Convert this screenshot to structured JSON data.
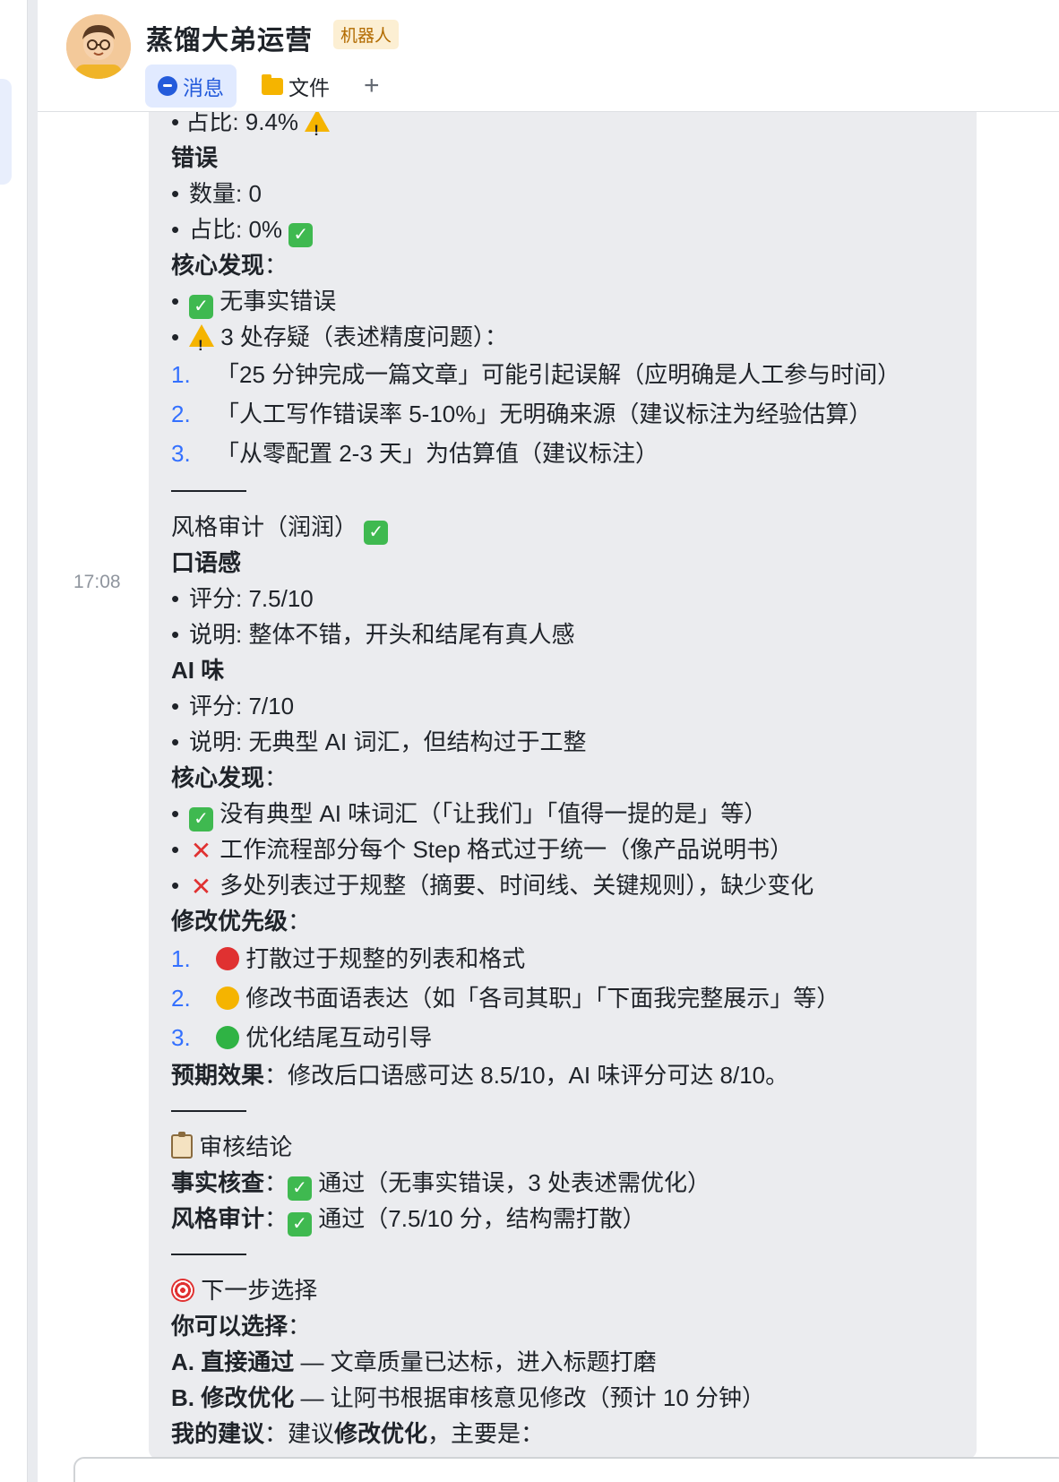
{
  "header": {
    "title": "蒸馏大弟运营",
    "badge": "机器人",
    "tabs": [
      {
        "label": "消息",
        "icon": "chat-bubble-icon",
        "active": true
      },
      {
        "label": "文件",
        "icon": "folder-icon",
        "active": false
      }
    ],
    "add_tab": "+"
  },
  "message": {
    "time": "17:08",
    "lines": {
      "l0": "• 占比: 9.4%",
      "l1": "错误",
      "l2": "数量: 0",
      "l3": "占比: 0%",
      "l4": "核心发现",
      "l4b": "：",
      "l5": "无事实错误",
      "l6": "3 处存疑（表述精度问题）：",
      "l7": "「25 分钟完成一篇文章」可能引起误解（应明确是人工参与时间）",
      "l8": "「人工写作错误率 5-10%」无明确来源（建议标注为经验估算）",
      "l9": "「从零配置 2-3 天」为估算值（建议标注）",
      "l10": "风格审计（润润）",
      "l11": "口语感",
      "l12": "评分: 7.5/10",
      "l13": "说明: 整体不错，开头和结尾有真人感",
      "l14": "AI 味",
      "l15": "评分: 7/10",
      "l16": "说明: 无典型 AI 词汇，但结构过于工整",
      "l17": "核心发现",
      "l17b": "：",
      "l18": "没有典型 AI 味词汇（「让我们」「值得一提的是」等）",
      "l19": "工作流程部分每个 Step 格式过于统一（像产品说明书）",
      "l20": "多处列表过于规整（摘要、时间线、关键规则），缺少变化",
      "l21": "修改优先级",
      "l21b": "：",
      "l22": "打散过于规整的列表和格式",
      "l23": "修改书面语表达（如「各司其职」「下面我完整展示」等）",
      "l24": "优化结尾互动引导",
      "l25a": "预期效果",
      "l25b": "：修改后口语感可达 8.5/10，AI 味评分可达 8/10。",
      "l26": "审核结论",
      "l27a": "事实核查",
      "l27b": "：",
      "l27c": "通过（无事实错误，3 处表述需优化）",
      "l28a": "风格审计",
      "l28b": "：",
      "l28c": "通过（7.5/10 分，结构需打散）",
      "l29": "下一步选择",
      "l30": "你可以选择",
      "l30b": "：",
      "l31a": "A. 直接通过",
      "l31b": " — 文章质量已达标，进入标题打磨",
      "l32a": "B. 修改优化",
      "l32b": " — 让阿书根据审核意见修改（预计 10 分钟）",
      "l33a": "我的建议",
      "l33b": "：建议",
      "l33c": "修改优化",
      "l33d": "，主要是："
    },
    "list_numbers": [
      "1.",
      "2.",
      "3."
    ],
    "bullet": "•"
  },
  "colors": {
    "accent": "#3370ff",
    "bubble": "#ebecef",
    "red": "#e03131",
    "yellow": "#f5b400",
    "green": "#2fb344"
  },
  "icons": [
    "chat-bubble-icon",
    "folder-icon",
    "plus-icon",
    "check-emoji-icon",
    "warning-emoji-icon",
    "cross-emoji-icon",
    "red-circle-icon",
    "yellow-circle-icon",
    "green-circle-icon",
    "clipboard-icon",
    "target-icon"
  ]
}
